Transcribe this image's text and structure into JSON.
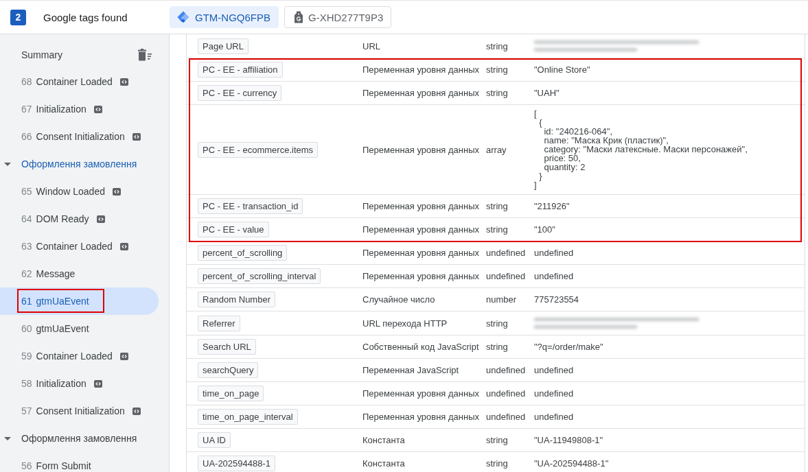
{
  "header": {
    "tag_count": "2",
    "title": "Google tags found",
    "tabs": [
      {
        "label": "GTM-NGQ6FPB",
        "kind": "gtm",
        "selected": true
      },
      {
        "label": "G-XHD277T9P3",
        "kind": "gtag",
        "selected": false
      }
    ]
  },
  "sidebar": {
    "summary": {
      "label": "Summary"
    },
    "items": [
      {
        "kind": "event",
        "number": "68",
        "label": "Container Loaded",
        "code_marker": true,
        "selected": false,
        "highlighted": false
      },
      {
        "kind": "event",
        "number": "67",
        "label": "Initialization",
        "code_marker": true,
        "selected": false,
        "highlighted": false
      },
      {
        "kind": "event",
        "number": "66",
        "label": "Consent Initialization",
        "code_marker": true,
        "selected": false,
        "highlighted": false
      },
      {
        "kind": "page",
        "label": "Оформлення замовлення",
        "expanded": true,
        "selected": true,
        "highlighted": false
      },
      {
        "kind": "event",
        "number": "65",
        "label": "Window Loaded",
        "code_marker": true,
        "selected": false,
        "highlighted": false
      },
      {
        "kind": "event",
        "number": "64",
        "label": "DOM Ready",
        "code_marker": true,
        "selected": false,
        "highlighted": false
      },
      {
        "kind": "event",
        "number": "63",
        "label": "Container Loaded",
        "code_marker": true,
        "selected": false,
        "highlighted": false
      },
      {
        "kind": "event",
        "number": "62",
        "label": "Message",
        "code_marker": false,
        "selected": false,
        "highlighted": false
      },
      {
        "kind": "event",
        "number": "61",
        "label": "gtmUaEvent",
        "code_marker": false,
        "selected": true,
        "highlighted": true
      },
      {
        "kind": "event",
        "number": "60",
        "label": "gtmUaEvent",
        "code_marker": false,
        "selected": false,
        "highlighted": false
      },
      {
        "kind": "event",
        "number": "59",
        "label": "Container Loaded",
        "code_marker": true,
        "selected": false,
        "highlighted": false
      },
      {
        "kind": "event",
        "number": "58",
        "label": "Initialization",
        "code_marker": true,
        "selected": false,
        "highlighted": false
      },
      {
        "kind": "event",
        "number": "57",
        "label": "Consent Initialization",
        "code_marker": true,
        "selected": false,
        "highlighted": false
      },
      {
        "kind": "page",
        "label": "Оформлення замовлення",
        "expanded": true,
        "selected": false,
        "highlighted": false
      },
      {
        "kind": "event",
        "number": "56",
        "label": "Form Submit",
        "code_marker": false,
        "selected": false,
        "highlighted": false
      }
    ]
  },
  "table": {
    "row_groups": [
      {
        "highlighted": false,
        "rows": [
          {
            "name": "Page URL",
            "type": "URL",
            "data_type": "string",
            "redacted": true
          }
        ]
      },
      {
        "highlighted": true,
        "rows": [
          {
            "name": "PC - EE - affiliation",
            "type": "Переменная уровня данных",
            "data_type": "string",
            "value": "\"Online Store\"",
            "redacted": false
          },
          {
            "name": "PC - EE - currency",
            "type": "Переменная уровня данных",
            "data_type": "string",
            "value": "\"UAH\"",
            "redacted": false
          },
          {
            "name": "PC - EE - ecommerce.items",
            "type": "Переменная уровня данных",
            "data_type": "array",
            "value": "[\n  {\n    id: \"240216-064\",\n    name: \"Маска Крик (пластик)\",\n    category: \"Маски латексные. Маски персонажей\",\n    price: 50,\n    quantity: 2\n  }\n]",
            "redacted": false
          },
          {
            "name": "PC - EE - transaction_id",
            "type": "Переменная уровня данных",
            "data_type": "string",
            "value": "\"211926\"",
            "redacted": false
          },
          {
            "name": "PC - EE - value",
            "type": "Переменная уровня данных",
            "data_type": "string",
            "value": "\"100\"",
            "redacted": false
          }
        ]
      },
      {
        "highlighted": false,
        "rows": [
          {
            "name": "percent_of_scrolling",
            "type": "Переменная уровня данных",
            "data_type": "undefined",
            "value": "undefined",
            "redacted": false
          },
          {
            "name": "percent_of_scrolling_interval",
            "type": "Переменная уровня данных",
            "data_type": "undefined",
            "value": "undefined",
            "redacted": false
          },
          {
            "name": "Random Number",
            "type": "Случайное число",
            "data_type": "number",
            "value": "775723554",
            "redacted": false
          },
          {
            "name": "Referrer",
            "type": "URL перехода HTTP",
            "data_type": "string",
            "redacted": true
          },
          {
            "name": "Search URL",
            "type": "Собственный код JavaScript",
            "data_type": "string",
            "value": "\"?q=/order/make\"",
            "redacted": false
          },
          {
            "name": "searchQuery",
            "type": "Переменная JavaScript",
            "data_type": "undefined",
            "value": "undefined",
            "redacted": false
          },
          {
            "name": "time_on_page",
            "type": "Переменная уровня данных",
            "data_type": "undefined",
            "value": "undefined",
            "redacted": false
          },
          {
            "name": "time_on_page_interval",
            "type": "Переменная уровня данных",
            "data_type": "undefined",
            "value": "undefined",
            "redacted": false
          },
          {
            "name": "UA ID",
            "type": "Константа",
            "data_type": "string",
            "value": "\"UA-11949808-1\"",
            "redacted": false
          },
          {
            "name": "UA-202594488-1",
            "type": "Константа",
            "data_type": "string",
            "value": "\"UA-202594488-1\"",
            "redacted": false
          }
        ]
      }
    ]
  }
}
